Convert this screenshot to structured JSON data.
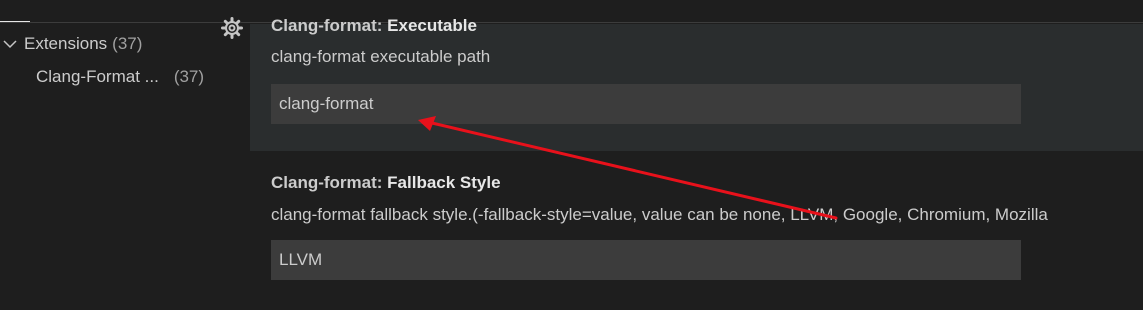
{
  "toc": {
    "items": [
      {
        "label": "Extensions",
        "count": "(37)"
      },
      {
        "label": "Clang-Format ...",
        "count": "(37)"
      }
    ]
  },
  "settings": [
    {
      "category": "Clang-format: ",
      "name": "Executable",
      "description": "clang-format executable path",
      "value": "clang-format"
    },
    {
      "category": "Clang-format: ",
      "name": "Fallback Style",
      "description": "clang-format fallback style.(-fallback-style=value, value can be none, LLVM, Google, Chromium, Mozilla",
      "value": "LLVM"
    }
  ],
  "colors": {
    "background": "#1e1e1e",
    "row_highlight": "#2a2d2e",
    "input_background": "#3c3c3c",
    "annotation_arrow": "#e8111b"
  },
  "icons": [
    "chevron-down-icon",
    "gear-icon"
  ]
}
